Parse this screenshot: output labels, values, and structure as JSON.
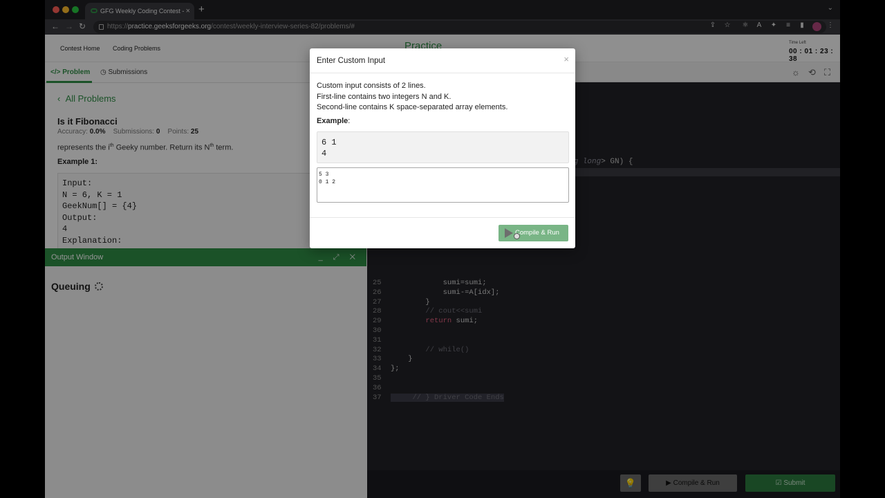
{
  "browser": {
    "tab_title": "GFG Weekly Coding Contest -",
    "tab_close": "×",
    "new_tab": "+",
    "tabs_menu": "⌄",
    "url_scheme": "https://",
    "url_domain": "practice.geeksforgeeks.org",
    "url_path": "/contest/weekly-interview-series-82/problems/#",
    "traffic_colors": [
      "#ff5f57",
      "#febc2e",
      "#28c840"
    ]
  },
  "site": {
    "nav": [
      "Contest Home",
      "Coding Problems"
    ],
    "logo": "Practice",
    "time_left_label": "Time Left",
    "time_left_value": "00 : 01 : 23 : 38"
  },
  "problem": {
    "tab_problem": "Problem",
    "tab_submissions": "Submissions",
    "back_link": "All Problems",
    "title": "Is it Fibonacci",
    "accuracy_label": "Accuracy:",
    "accuracy": "0.0%",
    "submissions_label": "Submissions:",
    "submissions": "0",
    "points_label": "Points:",
    "points": "25",
    "desc_pre": "represents the i",
    "desc_sup1": "th",
    "desc_mid": " Geeky number. Return its N",
    "desc_sup2": "th",
    "desc_post": " term.",
    "example_title": "Example 1:",
    "example_code": "Input:\nN = 6, K = 1\nGeekNum[] = {4}\nOutput:\n4\nExplanation:"
  },
  "output": {
    "title": "Output Window",
    "controls": "_ ⤢ ✕",
    "status": "Queuing"
  },
  "editor": {
    "fragment_pre": "ng long",
    "fragment_post": "> GN) {",
    "lines": [
      {
        "n": "25",
        "code": "            sumi=sumi;"
      },
      {
        "n": "26",
        "code": "            sumi-=A[idx];"
      },
      {
        "n": "27",
        "code": "        }"
      },
      {
        "n": "28",
        "code": "        // cout<<sumi"
      },
      {
        "n": "29",
        "code": "        return sumi;"
      },
      {
        "n": "30",
        "code": ""
      },
      {
        "n": "31",
        "code": ""
      },
      {
        "n": "32",
        "code": "        // while()"
      },
      {
        "n": "33",
        "code": "    }"
      },
      {
        "n": "34",
        "code": "};"
      },
      {
        "n": "35",
        "code": ""
      },
      {
        "n": "36",
        "code": ""
      },
      {
        "n": "37",
        "code": "     // } Driver Code Ends"
      }
    ],
    "compile_run": "Compile & Run",
    "submit": "Submit"
  },
  "modal": {
    "title": "Enter Custom Input",
    "close": "×",
    "info_line1": "Custom input consists of 2 lines.",
    "info_line2": "First-line contains two integers N and K.",
    "info_line3": "Second-line contains K space-separated array elements.",
    "example_label": "Example",
    "example_colon": ":",
    "example_value": "6 1\n4",
    "input_value": "5 3\n0 1 2",
    "button_label": "Compile & Run"
  }
}
